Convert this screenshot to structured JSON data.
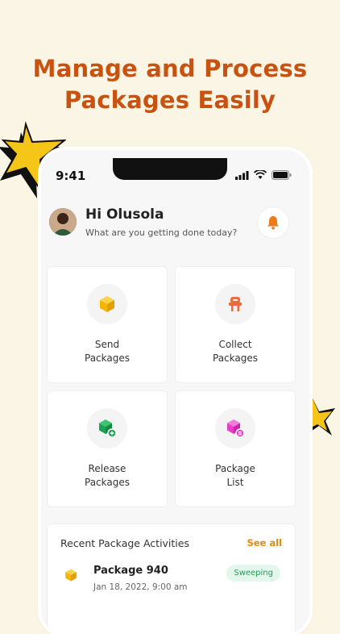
{
  "headline": {
    "line1": "Manage and Process",
    "line2": "Packages Easily"
  },
  "status_bar": {
    "time": "9:41"
  },
  "user": {
    "greeting": "Hi Olusola",
    "subtitle": "What are you getting done today?"
  },
  "actions": [
    {
      "line1": "Send",
      "line2": "Packages",
      "icon": "box-icon",
      "color": "#f5b400"
    },
    {
      "line1": "Collect",
      "line2": "Packages",
      "icon": "robot-collector-icon",
      "color": "#ef6a3a"
    },
    {
      "line1": "Release",
      "line2": "Packages",
      "icon": "box-release-icon",
      "color": "#1aa350"
    },
    {
      "line1": "Package",
      "line2": "List",
      "icon": "box-list-icon",
      "color": "#e63ec8"
    }
  ],
  "recent": {
    "title": "Recent Package Activities",
    "see_all": "See all",
    "items": [
      {
        "name": "Package 940",
        "date": "Jan 18, 2022, 9:00 am",
        "status": "Sweeping"
      }
    ]
  },
  "colors": {
    "background": "#fbf5e6",
    "headline": "#c8520f",
    "accent": "#e88a00",
    "badge_text": "#1f9d55",
    "badge_bg": "#e4f7ec"
  }
}
